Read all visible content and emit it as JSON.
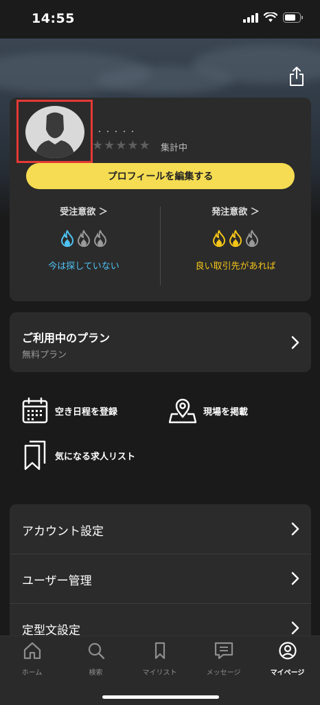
{
  "status_bar": {
    "time": "14:55"
  },
  "profile": {
    "name_masked": "・・・・・",
    "rating_stars": "★★★★★",
    "rating_label": "集計中",
    "edit_button": "プロフィールを編集する"
  },
  "willingness": {
    "receive": {
      "title": "受注意欲 ＞",
      "level": 1,
      "max": 3,
      "status": "今は探していない",
      "color": "#4fc3f7"
    },
    "order": {
      "title": "発注意欲 ＞",
      "level": 2,
      "max": 3,
      "status": "良い取引先があれば",
      "color": "#f5c518"
    }
  },
  "plan": {
    "title": "ご利用中のプラン",
    "name": "無料プラン"
  },
  "quick_actions": [
    {
      "label": "空き日程を登録",
      "icon": "calendar-icon"
    },
    {
      "label": "現場を掲載",
      "icon": "map-pin-icon"
    },
    {
      "label": "気になる求人リスト",
      "icon": "bookmark-icon"
    }
  ],
  "settings": [
    {
      "label": "アカウント設定"
    },
    {
      "label": "ユーザー管理"
    },
    {
      "label": "定型文設定"
    }
  ],
  "tabs": [
    {
      "label": "ホーム",
      "icon": "home-icon"
    },
    {
      "label": "検索",
      "icon": "search-icon"
    },
    {
      "label": "マイリスト",
      "icon": "bookmark-icon"
    },
    {
      "label": "メッセージ",
      "icon": "message-icon"
    },
    {
      "label": "マイページ",
      "icon": "user-circle-icon",
      "active": true
    }
  ],
  "colors": {
    "accent_yellow": "#f5dc52",
    "card_bg": "#2b2b2b",
    "highlight_red": "#e53935"
  }
}
